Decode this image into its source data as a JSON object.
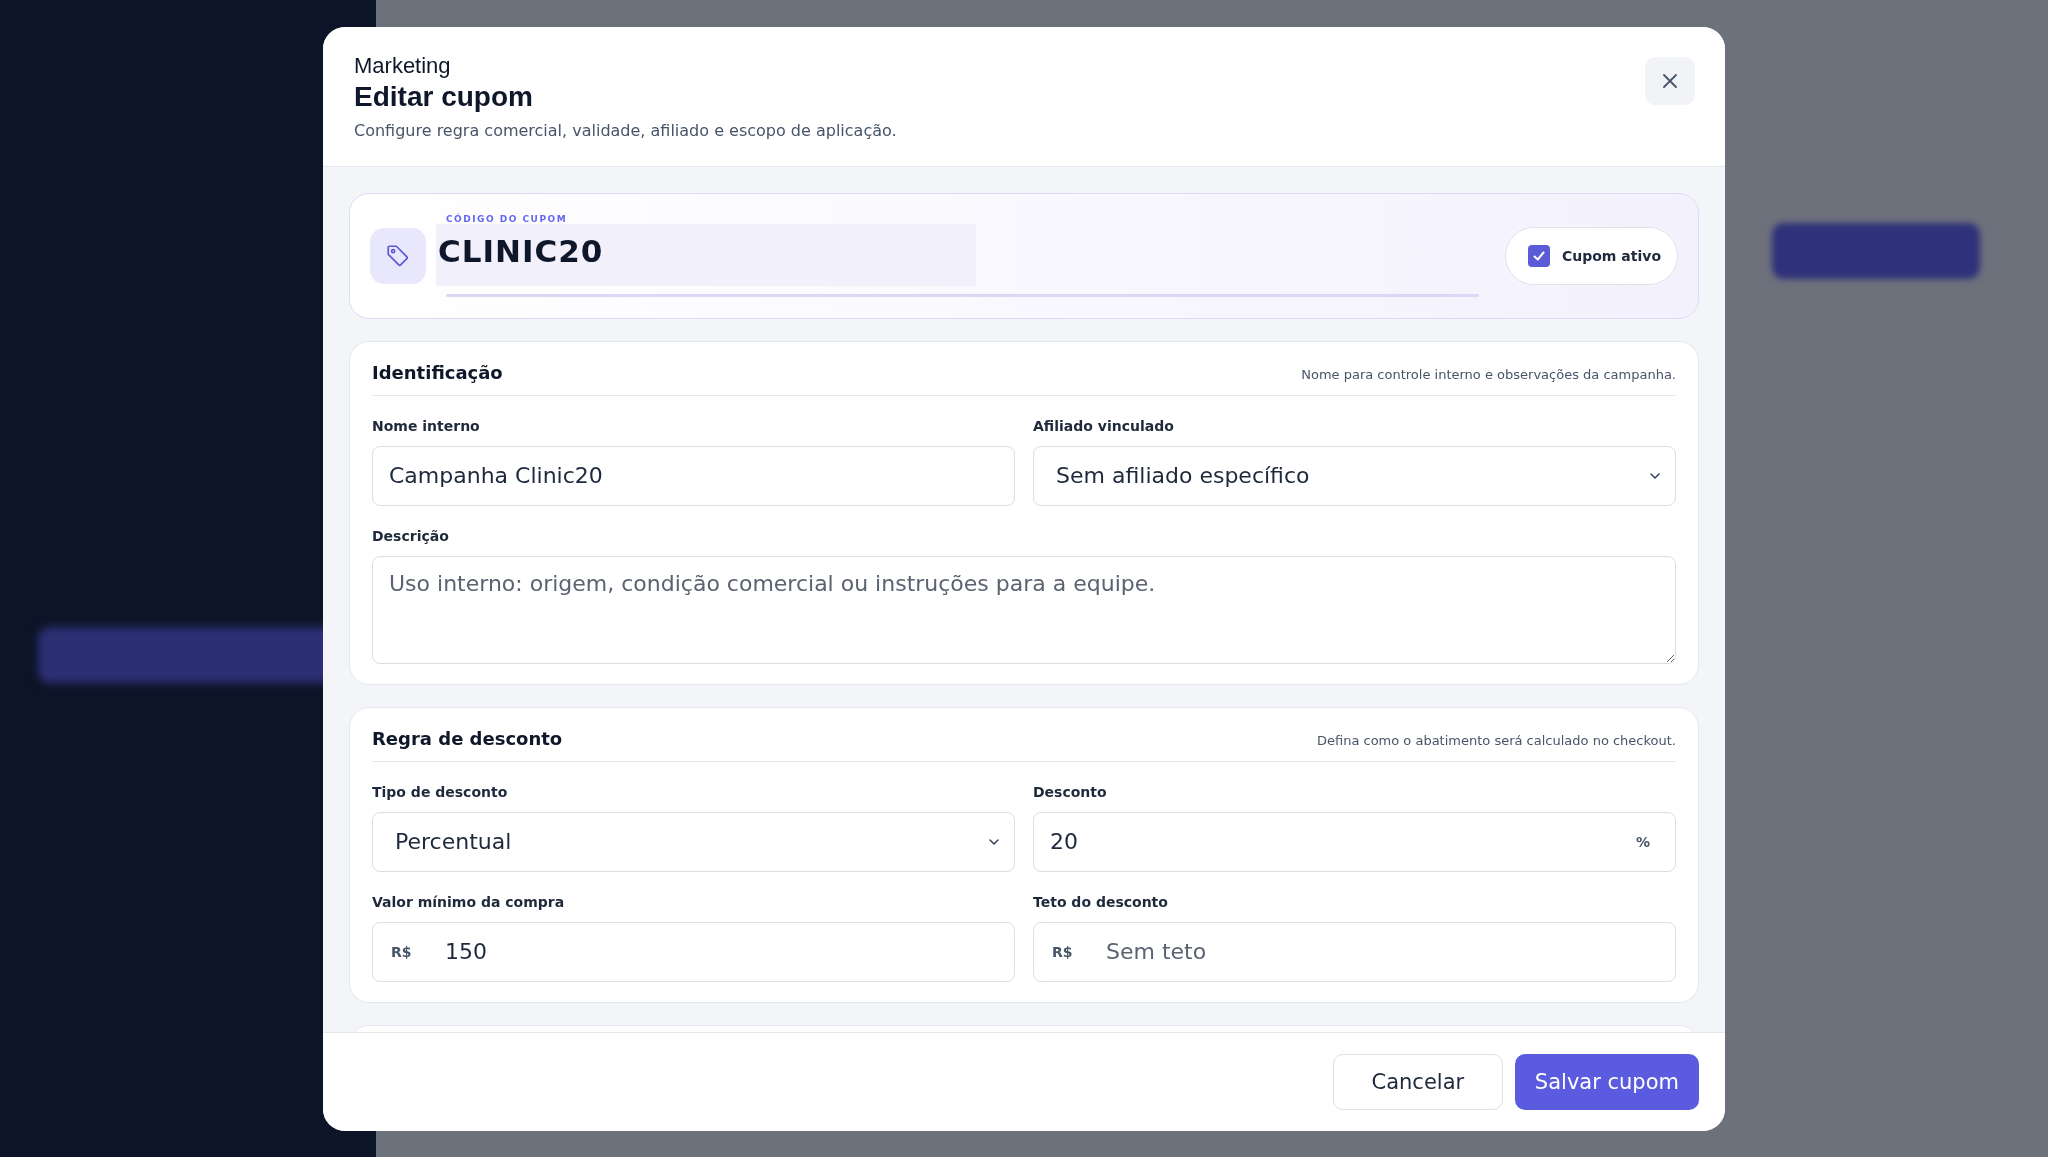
{
  "modal": {
    "eyebrow": "Marketing",
    "title": "Editar cupom",
    "subtitle": "Configure regra comercial, validade, afiliado e escopo de aplicação."
  },
  "coupon": {
    "label": "CÓDIGO DO CUPOM",
    "code": "CLINIC20",
    "active": {
      "label": "Cupom ativo",
      "checked": true
    }
  },
  "sections": [
    {
      "title": "Identificação",
      "hint": "Nome para controle interno e observações da campanha.",
      "fields": [
        {
          "kind": "text",
          "label": "Nome interno",
          "value": "Campanha Clinic20"
        },
        {
          "kind": "select",
          "label": "Afiliado vinculado",
          "value": "Sem afiliado específico"
        },
        {
          "kind": "textarea",
          "label": "Descrição",
          "placeholder": "Uso interno: origem, condição comercial ou instruções para a equipe."
        }
      ]
    },
    {
      "title": "Regra de desconto",
      "hint": "Defina como o abatimento será calculado no checkout.",
      "fields": [
        {
          "kind": "select",
          "label": "Tipo de desconto",
          "value": "Percentual"
        },
        {
          "kind": "suffix",
          "label": "Desconto",
          "value": "20",
          "suffix": "%"
        },
        {
          "kind": "prefix",
          "label": "Valor mínimo da compra",
          "prefix": "R$",
          "value": "150"
        },
        {
          "kind": "prefix",
          "label": "Teto do desconto",
          "prefix": "R$",
          "placeholder": "Sem teto"
        }
      ]
    }
  ],
  "buttons": [
    {
      "label": "Cancelar",
      "kind": "secondary"
    },
    {
      "label": "Salvar cupom",
      "kind": "primary"
    }
  ]
}
